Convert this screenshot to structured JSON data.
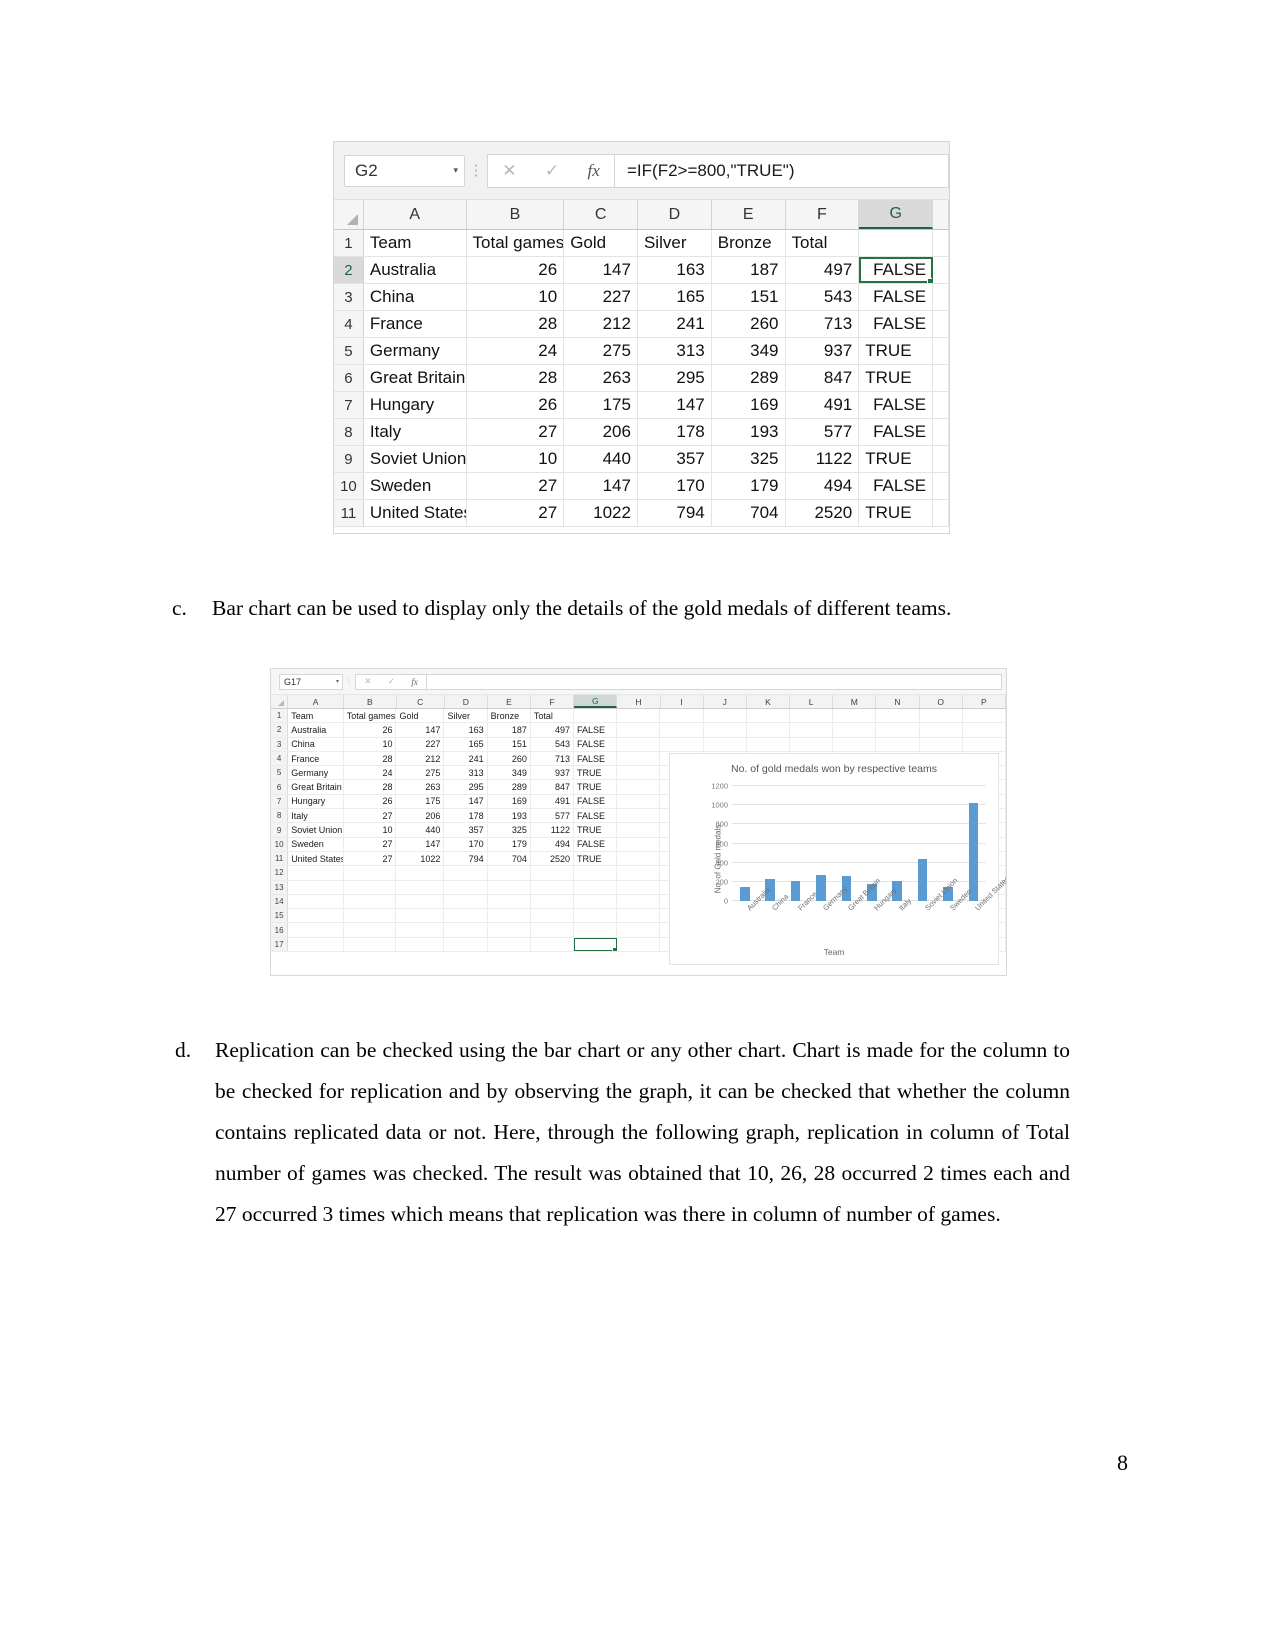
{
  "page": {
    "number": "8"
  },
  "screenshot1": {
    "name_box": "G2",
    "formula": "=IF(F2>=800,\"TRUE\")",
    "icons": {
      "cancel": "✕",
      "confirm": "✓",
      "function": "fx",
      "dropdown": "▾",
      "menu": "⋮"
    },
    "columns": [
      "A",
      "B",
      "C",
      "D",
      "E",
      "F",
      "G"
    ],
    "selected_column": "G",
    "selected_row": "2",
    "row_numbers": [
      "1",
      "2",
      "3",
      "4",
      "5",
      "6",
      "7",
      "8",
      "9",
      "10",
      "11"
    ],
    "header_row": [
      "Team",
      "Total games",
      "Gold",
      "Silver",
      "Bronze",
      "Total",
      ""
    ],
    "rows": [
      {
        "team": "Australia",
        "total_games": "26",
        "gold": "147",
        "silver": "163",
        "bronze": "187",
        "total": "497",
        "flag": "FALSE"
      },
      {
        "team": "China",
        "total_games": "10",
        "gold": "227",
        "silver": "165",
        "bronze": "151",
        "total": "543",
        "flag": "FALSE"
      },
      {
        "team": "France",
        "total_games": "28",
        "gold": "212",
        "silver": "241",
        "bronze": "260",
        "total": "713",
        "flag": "FALSE"
      },
      {
        "team": "Germany",
        "total_games": "24",
        "gold": "275",
        "silver": "313",
        "bronze": "349",
        "total": "937",
        "flag": "TRUE"
      },
      {
        "team": "Great Britain",
        "total_games": "28",
        "gold": "263",
        "silver": "295",
        "bronze": "289",
        "total": "847",
        "flag": "TRUE"
      },
      {
        "team": "Hungary",
        "total_games": "26",
        "gold": "175",
        "silver": "147",
        "bronze": "169",
        "total": "491",
        "flag": "FALSE"
      },
      {
        "team": "Italy",
        "total_games": "27",
        "gold": "206",
        "silver": "178",
        "bronze": "193",
        "total": "577",
        "flag": "FALSE"
      },
      {
        "team": "Soviet Union",
        "total_games": "10",
        "gold": "440",
        "silver": "357",
        "bronze": "325",
        "total": "1122",
        "flag": "TRUE"
      },
      {
        "team": "Sweden",
        "total_games": "27",
        "gold": "147",
        "silver": "170",
        "bronze": "179",
        "total": "494",
        "flag": "FALSE"
      },
      {
        "team": "United States",
        "total_games": "27",
        "gold": "1022",
        "silver": "794",
        "bronze": "704",
        "total": "2520",
        "flag": "TRUE"
      }
    ]
  },
  "paragraph_c": {
    "marker": "c.",
    "text": "Bar chart can be used to display only the details of the gold medals of different teams."
  },
  "screenshot2": {
    "name_box": "G17",
    "formula": "",
    "icons": {
      "cancel": "✕",
      "confirm": "✓",
      "function": "fx",
      "dropdown": "▾",
      "menu": "⋮"
    },
    "columns": [
      "A",
      "B",
      "C",
      "D",
      "E",
      "F",
      "G",
      "H",
      "I",
      "J",
      "K",
      "L",
      "M",
      "N",
      "O",
      "P"
    ],
    "selected_column": "G",
    "selected_cell": "G17",
    "row_numbers": [
      "1",
      "2",
      "3",
      "4",
      "5",
      "6",
      "7",
      "8",
      "9",
      "10",
      "11",
      "12",
      "13",
      "14",
      "15",
      "16",
      "17"
    ],
    "header_row": [
      "Team",
      "Total games",
      "Gold",
      "Silver",
      "Bronze",
      "Total",
      ""
    ],
    "rows": [
      {
        "team": "Australia",
        "total_games": "26",
        "gold": "147",
        "silver": "163",
        "bronze": "187",
        "total": "497",
        "flag": "FALSE"
      },
      {
        "team": "China",
        "total_games": "10",
        "gold": "227",
        "silver": "165",
        "bronze": "151",
        "total": "543",
        "flag": "FALSE"
      },
      {
        "team": "France",
        "total_games": "28",
        "gold": "212",
        "silver": "241",
        "bronze": "260",
        "total": "713",
        "flag": "FALSE"
      },
      {
        "team": "Germany",
        "total_games": "24",
        "gold": "275",
        "silver": "313",
        "bronze": "349",
        "total": "937",
        "flag": "TRUE"
      },
      {
        "team": "Great Britain",
        "total_games": "28",
        "gold": "263",
        "silver": "295",
        "bronze": "289",
        "total": "847",
        "flag": "TRUE"
      },
      {
        "team": "Hungary",
        "total_games": "26",
        "gold": "175",
        "silver": "147",
        "bronze": "169",
        "total": "491",
        "flag": "FALSE"
      },
      {
        "team": "Italy",
        "total_games": "27",
        "gold": "206",
        "silver": "178",
        "bronze": "193",
        "total": "577",
        "flag": "FALSE"
      },
      {
        "team": "Soviet Union",
        "total_games": "10",
        "gold": "440",
        "silver": "357",
        "bronze": "325",
        "total": "1122",
        "flag": "TRUE"
      },
      {
        "team": "Sweden",
        "total_games": "27",
        "gold": "147",
        "silver": "170",
        "bronze": "179",
        "total": "494",
        "flag": "FALSE"
      },
      {
        "team": "United States",
        "total_games": "27",
        "gold": "1022",
        "silver": "794",
        "bronze": "704",
        "total": "2520",
        "flag": "TRUE"
      }
    ]
  },
  "chart_data": {
    "type": "bar",
    "title": "No. of gold medals won by respective teams",
    "xlabel": "Team",
    "ylabel": "No. of Gold medals",
    "categories": [
      "Australia",
      "China",
      "France",
      "Germany",
      "Great Britain",
      "Hungary",
      "Italy",
      "Soviet Union",
      "Sweden",
      "United States"
    ],
    "values": [
      147,
      227,
      212,
      275,
      263,
      175,
      206,
      440,
      147,
      1022
    ],
    "yticks": [
      0,
      200,
      400,
      600,
      800,
      1000,
      1200
    ],
    "ylim": [
      0,
      1200
    ],
    "series_color": "#5b9bd5",
    "grid": true,
    "legend": "none"
  },
  "paragraph_d": {
    "marker": "d.",
    "text": "Replication can be checked using the bar chart or any other chart. Chart is made for the column to be checked for replication and by observing the graph, it can be checked that whether the column contains replicated data or not. Here, through the following graph, replication in column of Total number of games was checked. The result was obtained that 10, 26, 28 occurred 2 times each and 27 occurred 3 times which means that replication was there in column of number of games."
  }
}
